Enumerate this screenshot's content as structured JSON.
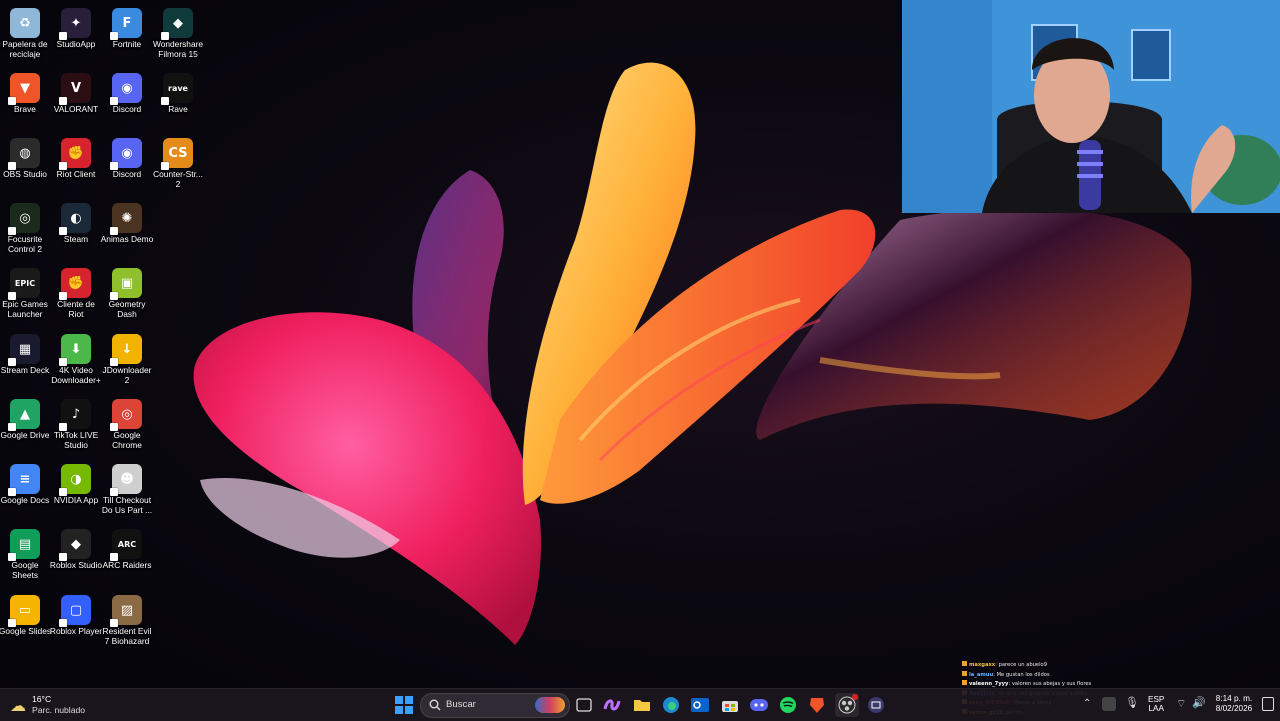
{
  "desktop": {
    "icons": [
      {
        "label": "Papelera de reciclaje",
        "icon": "recycle-bin-icon",
        "color": "#8fb7d8"
      },
      {
        "label": "StudioApp",
        "icon": "studioapp-icon",
        "color": "#2a1f3a"
      },
      {
        "label": "Fortnite",
        "icon": "fortnite-icon",
        "color": "#3a8be0"
      },
      {
        "label": "Wondershare Filmora 15",
        "icon": "filmora-icon",
        "color": "#0f3c3a"
      },
      {
        "label": "Brave",
        "icon": "brave-icon",
        "color": "#f0552a"
      },
      {
        "label": "VALORANT",
        "icon": "valorant-icon",
        "color": "#2a0e14"
      },
      {
        "label": "Discord",
        "icon": "discord-icon",
        "color": "#5865f2"
      },
      {
        "label": "Rave",
        "icon": "rave-icon",
        "color": "#111111"
      },
      {
        "label": "OBS Studio",
        "icon": "obs-icon",
        "color": "#2b2b2b"
      },
      {
        "label": "Riot Client",
        "icon": "riot-client-icon",
        "color": "#d6232e"
      },
      {
        "label": "Discord",
        "icon": "discord-icon",
        "color": "#5865f2"
      },
      {
        "label": "Counter-Str... 2",
        "icon": "counter-strike-icon",
        "color": "#e58b19"
      },
      {
        "label": "Focusrite Control 2",
        "icon": "focusrite-icon",
        "color": "#1b2a1b"
      },
      {
        "label": "Steam",
        "icon": "steam-icon",
        "color": "#1b2838"
      },
      {
        "label": "Animas Demo",
        "icon": "animas-icon",
        "color": "#4a3320"
      },
      {
        "label": "Epic Games Launcher",
        "icon": "epic-games-icon",
        "color": "#1a1a1a"
      },
      {
        "label": "Cliente de Riot",
        "icon": "riot-client-icon",
        "color": "#d6232e"
      },
      {
        "label": "Geometry Dash",
        "icon": "geometry-dash-icon",
        "color": "#8fbf2a"
      },
      {
        "label": "Stream Deck",
        "icon": "stream-deck-icon",
        "color": "#1a1a2e"
      },
      {
        "label": "4K Video Downloader+",
        "icon": "4k-video-downloader-icon",
        "color": "#4db84a"
      },
      {
        "label": "JDownloader 2",
        "icon": "jdownloader-icon",
        "color": "#f0b400"
      },
      {
        "label": "Google Drive",
        "icon": "google-drive-icon",
        "color": "#1fa463"
      },
      {
        "label": "TikTok LIVE Studio",
        "icon": "tiktok-icon",
        "color": "#111111"
      },
      {
        "label": "Google Chrome",
        "icon": "chrome-icon",
        "color": "#db4437"
      },
      {
        "label": "Google Docs",
        "icon": "google-docs-icon",
        "color": "#4285f4"
      },
      {
        "label": "NVIDIA App",
        "icon": "nvidia-icon",
        "color": "#76b900"
      },
      {
        "label": "Till Checkout Do Us Part ...",
        "icon": "game-portrait-icon",
        "color": "#cfcfcf"
      },
      {
        "label": "Google Sheets",
        "icon": "google-sheets-icon",
        "color": "#0f9d58"
      },
      {
        "label": "Roblox Studio",
        "icon": "roblox-studio-icon",
        "color": "#222222"
      },
      {
        "label": "ARC Raiders",
        "icon": "arc-raiders-icon",
        "color": "#111111"
      },
      {
        "label": "Google Slides",
        "icon": "google-slides-icon",
        "color": "#f4b400"
      },
      {
        "label": "Roblox Player",
        "icon": "roblox-player-icon",
        "color": "#335fff"
      },
      {
        "label": "Resident Evil 7 Biohazard",
        "icon": "resident-evil-icon",
        "color": "#8a6a45"
      }
    ],
    "glyphs": {
      "Papelera de reciclaje": "♻",
      "StudioApp": "✦",
      "Fortnite": "F",
      "Wondershare Filmora 15": "◆",
      "Brave": "▼",
      "VALORANT": "V",
      "Discord": "◉",
      "Rave": "rave",
      "OBS Studio": "◍",
      "Riot Client": "✊",
      "Counter-Str... 2": "CS",
      "Focusrite Control 2": "◎",
      "Steam": "◐",
      "Animas Demo": "✺",
      "Epic Games Launcher": "EPIC",
      "Cliente de Riot": "✊",
      "Geometry Dash": "▣",
      "Stream Deck": "▦",
      "4K Video Downloader+": "⬇",
      "JDownloader 2": "↓",
      "Google Drive": "▲",
      "TikTok LIVE Studio": "♪",
      "Google Chrome": "◎",
      "Google Docs": "≡",
      "NVIDIA App": "◑",
      "Till Checkout Do Us Part ...": "☻",
      "Google Sheets": "▤",
      "Roblox Studio": "◆",
      "ARC Raiders": "ARC",
      "Google Slides": "▭",
      "Roblox Player": "▢",
      "Resident Evil 7 Biohazard": "▨"
    }
  },
  "chat": {
    "messages": [
      {
        "user": "maxgaxx",
        "text": ": parece un abuelo9",
        "color": "#f0c040"
      },
      {
        "user": "la_amuu",
        "text": ": Me gustan los dildos",
        "color": "#6ab7ff"
      },
      {
        "user": "valeenn_7yyy",
        "text": ": valoren sus abejas y sus flores",
        "color": "#ffffff"
      },
      {
        "user": "Rea1Lizz",
        "text": ": no otra vez guiando a este autista",
        "color": "#6ab7ff"
      },
      {
        "user": "ezeg_DiCY0u0",
        "text": ": Menos a Stingi",
        "color": "#ff5050"
      },
      {
        "user": "samix_gz32",
        "text": ": por fin",
        "color": "#f0c040"
      }
    ]
  },
  "taskbar": {
    "weather": {
      "temp": "16°C",
      "condition": "Parc. nublado"
    },
    "search_placeholder": "Buscar",
    "apps": [
      "windows-start-icon",
      "search-icon",
      "task-view-icon",
      "copilot-icon",
      "file-explorer-icon",
      "edge-icon",
      "outlook-icon",
      "store-icon",
      "discord-icon",
      "spotify-icon",
      "brave-icon",
      "obs-icon",
      "stream-deck-icon"
    ],
    "tray": {
      "lang_top": "ESP",
      "lang_bottom": "LAA",
      "time": "8:14 p. m.",
      "date": "8/02/2026"
    }
  },
  "colors": {
    "taskbar_bg": "#1c161e",
    "accent": "#0078d4"
  }
}
